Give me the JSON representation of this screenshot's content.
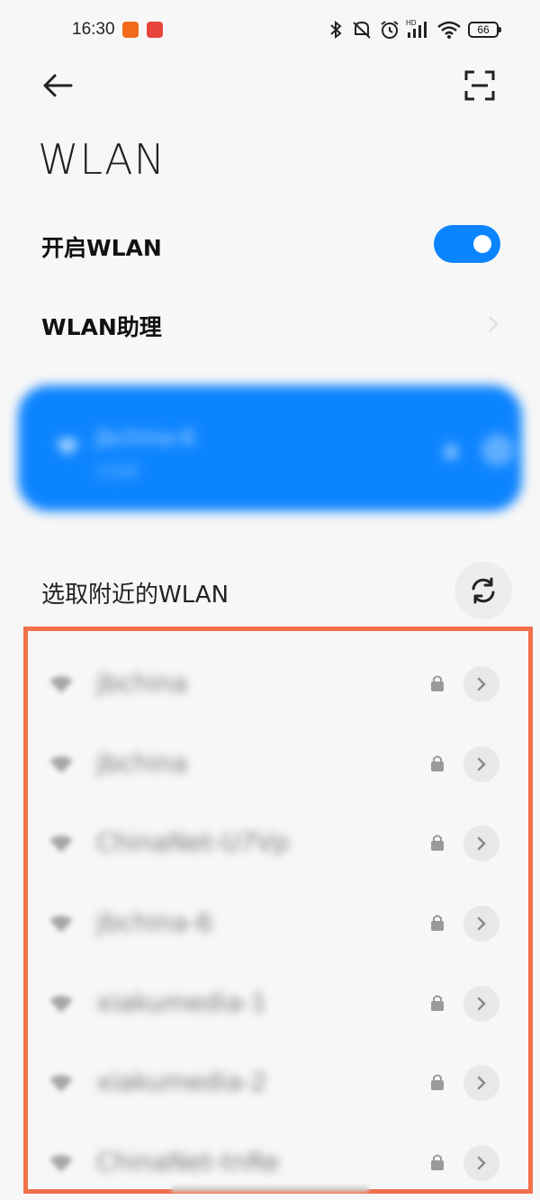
{
  "status_bar": {
    "time": "16:30",
    "battery": "66",
    "icons": [
      "bluetooth-icon",
      "mute-icon",
      "alarm-icon",
      "hd-signal-icon",
      "wifi-icon"
    ]
  },
  "header": {
    "back_icon": "back-arrow-icon",
    "scan_icon": "scan-icon",
    "title": "WLAN"
  },
  "settings": {
    "enable_label": "开启WLAN",
    "enable_on": true,
    "assistant_label": "WLAN助理"
  },
  "connected": {
    "ssid": "jbchina-6",
    "subtitle": "已连接"
  },
  "nearby": {
    "title": "选取附近的WLAN",
    "networks": [
      {
        "ssid": "jbchina"
      },
      {
        "ssid": "jbchina"
      },
      {
        "ssid": "ChinaNet-U7Vp"
      },
      {
        "ssid": "jbchina-6"
      },
      {
        "ssid": "xiakumedia-1"
      },
      {
        "ssid": "xiakumedia-2"
      },
      {
        "ssid": "ChinaNet-tnRe"
      }
    ]
  },
  "colors": {
    "accent": "#0b84ff",
    "highlight_border": "#f2704a"
  }
}
